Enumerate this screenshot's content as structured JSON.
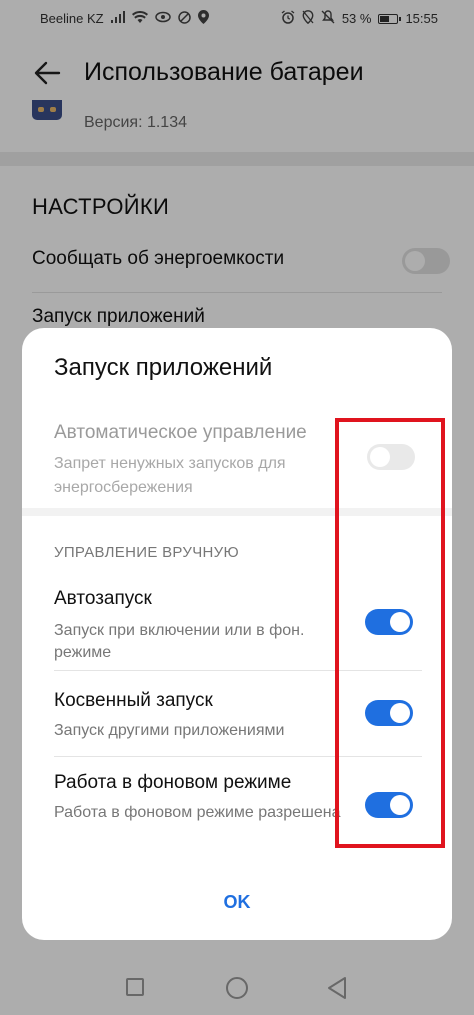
{
  "status_bar": {
    "carrier": "Beeline KZ",
    "battery": "53 %",
    "time": "15:55"
  },
  "app_bar": {
    "title": "Использование батареи",
    "version": "Версия: 1.134"
  },
  "settings": {
    "header": "НАСТРОЙКИ",
    "notify_label": "Сообщать об энергоемкости",
    "notify_enabled": false,
    "launch_label": "Запуск приложений"
  },
  "dialog": {
    "title": "Запуск приложений",
    "auto": {
      "title": "Автоматическое управление",
      "subtitle": "Запрет ненужных запусков для энергосбережения",
      "enabled": false
    },
    "manual_header": "УПРАВЛЕНИЕ ВРУЧНУЮ",
    "items": [
      {
        "title": "Автозапуск",
        "subtitle": "Запуск при включении или в фон. режиме",
        "enabled": true
      },
      {
        "title": "Косвенный запуск",
        "subtitle": "Запуск другими приложениями",
        "enabled": true
      },
      {
        "title": "Работа в фоновом режиме",
        "subtitle": "Работа в фоновом режиме разрешена",
        "enabled": true
      }
    ],
    "ok_label": "OK"
  },
  "colors": {
    "accent": "#1f6fe0",
    "highlight": "#e0141e"
  }
}
